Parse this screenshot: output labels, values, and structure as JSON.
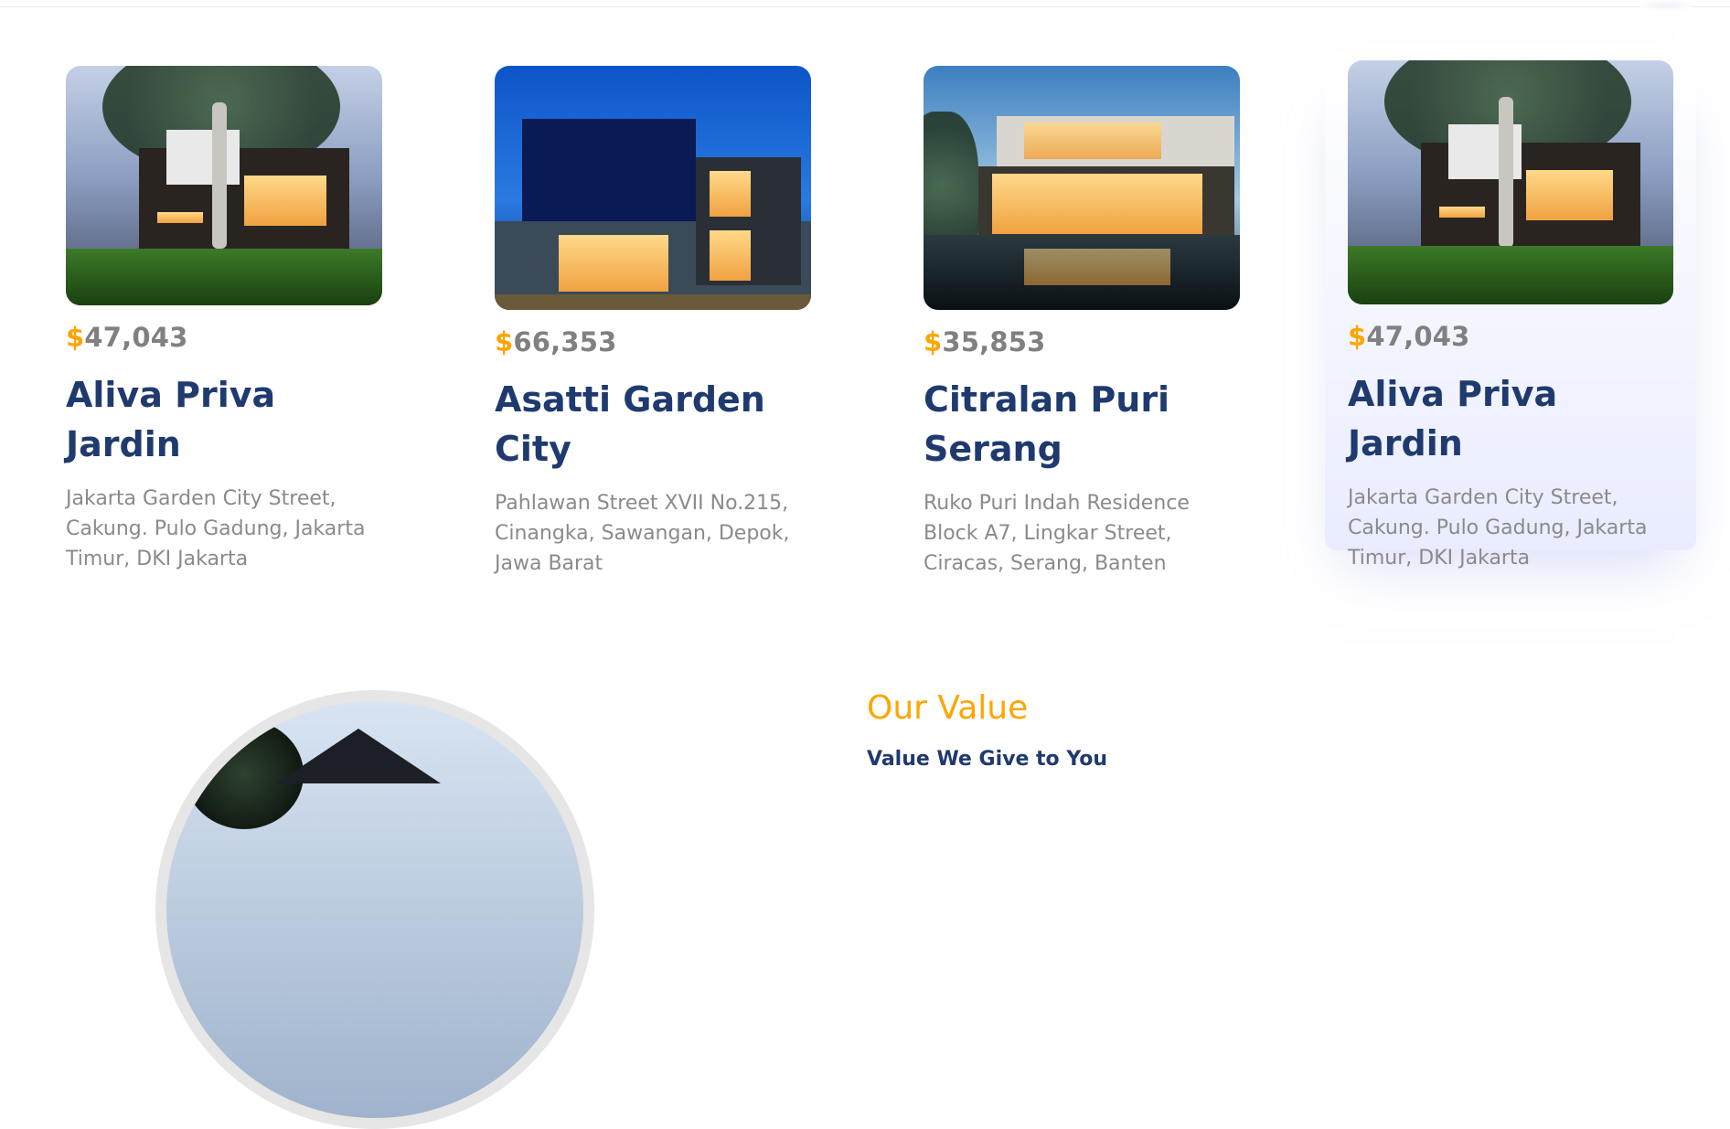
{
  "residences": [
    {
      "currency": "$",
      "price": "47,043",
      "title": "Aliva Priva Jardin",
      "address": "Jakarta Garden City Street, Cakung. Pulo Gadung, Jakarta Timur, DKI Jakarta"
    },
    {
      "currency": "$",
      "price": "66,353",
      "title": "Asatti Garden City",
      "address": "Pahlawan Street XVII No.215, Cinangka, Sawangan, Depok, Jawa Barat"
    },
    {
      "currency": "$",
      "price": "35,853",
      "title": "Citralan Puri Serang",
      "address": "Ruko Puri Indah Residence Block A7, Lingkar Street, Ciracas, Serang, Banten"
    },
    {
      "currency": "$",
      "price": "47,043",
      "title": "Aliva Priva Jardin",
      "address": "Jakarta Garden City Street, Cakung. Pulo Gadung, Jakarta Timur, DKI Jakarta"
    }
  ],
  "value_section": {
    "heading": "Our Value",
    "subheading": "Value We Give to You"
  },
  "colors": {
    "accent": "#ffa500",
    "title": "#1f3a6e",
    "muted": "#8a8a8a"
  }
}
